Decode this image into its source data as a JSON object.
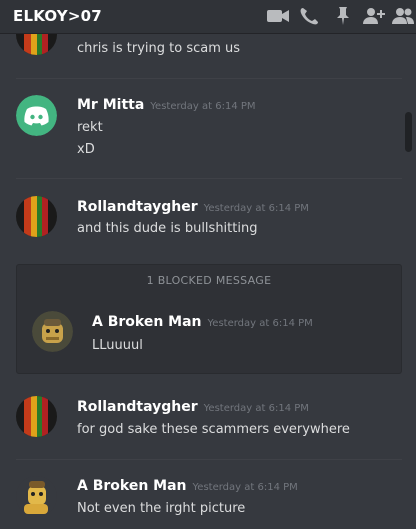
{
  "header": {
    "channel": "ELKOY>07",
    "icons": [
      "video-call-icon",
      "voice-call-icon",
      "pin-icon",
      "add-member-icon",
      "members-icon"
    ]
  },
  "messages": [
    {
      "text": "chris is trying to scam us"
    },
    {
      "author": "Mr Mitta",
      "timestamp": "Yesterday at 6:14 PM",
      "lines": [
        "rekt",
        "xD"
      ]
    },
    {
      "author": "Rollandtaygher",
      "timestamp": "Yesterday at 6:14 PM",
      "lines": [
        "and this dude is bullshitting"
      ]
    },
    {
      "author": "Rollandtaygher",
      "timestamp": "Yesterday at 6:14 PM",
      "lines": [
        "for god sake these scammers everywhere"
      ]
    },
    {
      "author": "A Broken Man",
      "timestamp": "Yesterday at 6:14 PM",
      "lines": [
        "Not even the irght picture"
      ]
    }
  ],
  "blocked": {
    "label": "1 BLOCKED MESSAGE",
    "author": "A Broken Man",
    "timestamp": "Yesterday at 6:14 PM",
    "text": "LLuuuul"
  },
  "colors": {
    "background": "#36393f",
    "topbar": "#303338",
    "discord_blurple_avatar": "#43b581",
    "timestamp": "#72767d"
  }
}
